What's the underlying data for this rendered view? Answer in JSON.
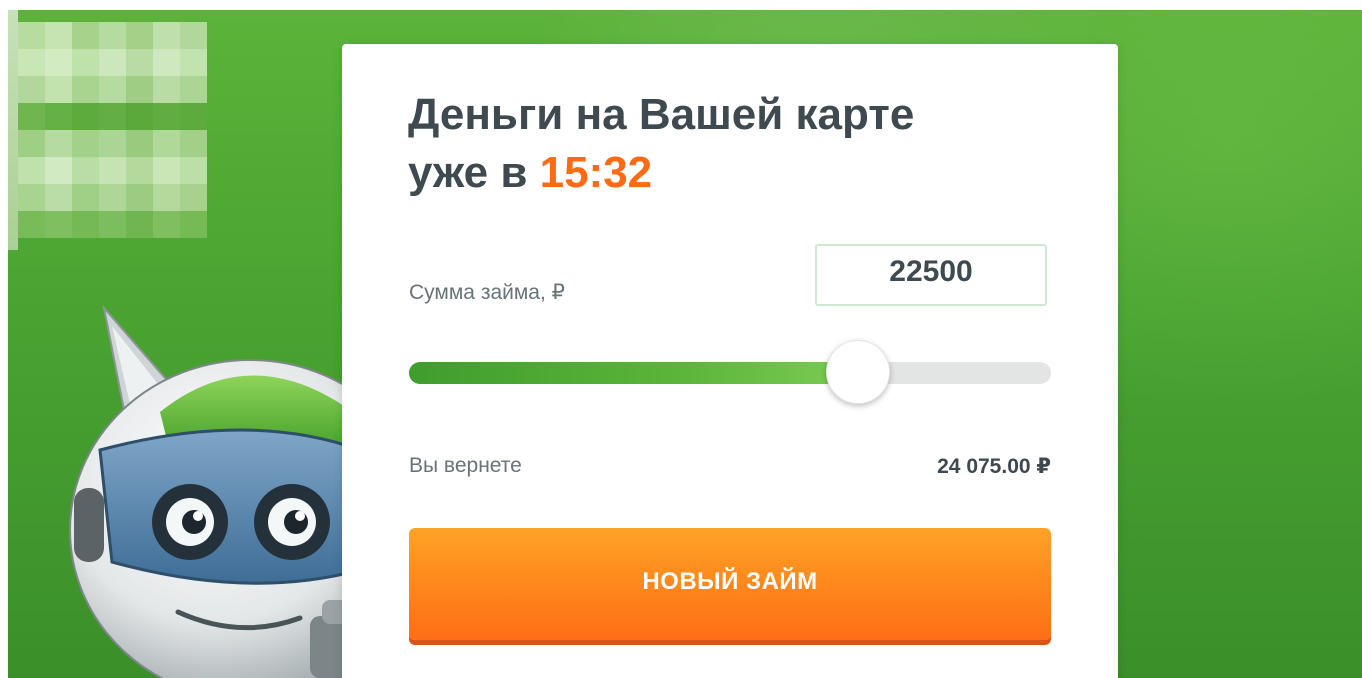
{
  "card": {
    "title_line1": "Деньги на Вашей карте",
    "title_prefix": "уже в",
    "title_time": "15:32"
  },
  "loan": {
    "amount_label": "Сумма займа, ₽",
    "amount_value": "22500",
    "slider_fraction": 0.7,
    "repay_label": "Вы вернете",
    "repay_value": "24 075.00 ₽"
  },
  "cta": {
    "label": "НОВЫЙ ЗАЙМ"
  },
  "icons": {
    "logo": "blurred-logo-icon",
    "mascot": "robot-cat-mascot-icon",
    "thumb": "slider-thumb-icon"
  },
  "colors": {
    "background_green": "#4aa331",
    "accent_orange": "#ff6a14",
    "slider_green": "#5bb53a",
    "text_dark": "#3e4a4f",
    "text_muted": "#6a7377"
  }
}
